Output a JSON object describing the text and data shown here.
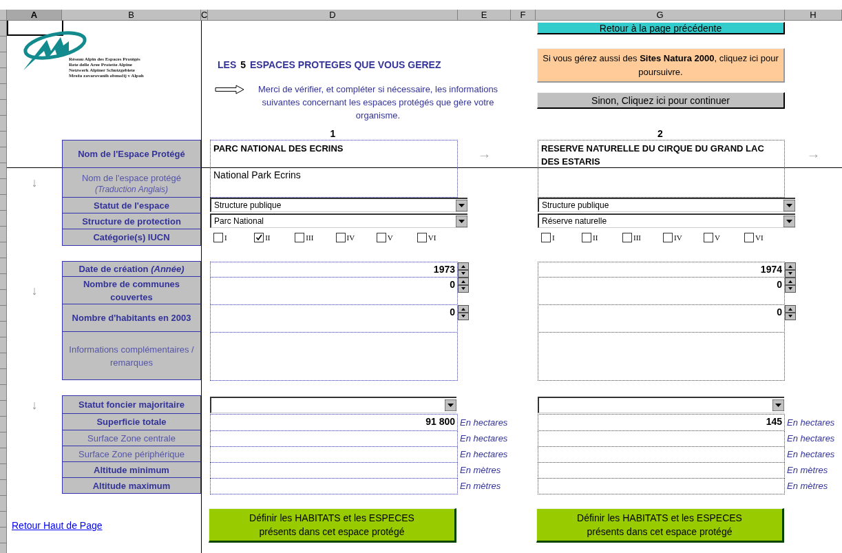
{
  "column_headers": [
    {
      "label": "A",
      "selected": true
    },
    {
      "label": "B",
      "selected": false
    },
    {
      "label": "C",
      "selected": false
    },
    {
      "label": "D",
      "selected": false
    },
    {
      "label": "E",
      "selected": false
    },
    {
      "label": "F",
      "selected": false
    },
    {
      "label": "G",
      "selected": false
    },
    {
      "label": "H",
      "selected": false
    }
  ],
  "logo": {
    "lines": [
      "Réseau Alpin des Espaces Protégés",
      "Rete delle Aree Protette Alpine",
      "Netzwerk Alpiner Schutzgebiete",
      "Mreža zavarovanih območij v Alpah"
    ]
  },
  "title": {
    "prefix": "LES",
    "count": "5",
    "suffix": "ESPACES PROTEGES QUE VOUS GEREZ"
  },
  "instruction": "Merci de vérifier, et compléter si nécessaire, les informations suivantes concernant les espaces protégés que gère votre organisme.",
  "top_buttons": {
    "back": "Retour à la page précédente",
    "natura": "Si vous gérez aussi des **Sites Natura 2000**, cliquez ici pour poursuivre.",
    "continue": "Sinon, Cliquez ici pour continuer"
  },
  "labels": [
    {
      "text": "Nom de l'Espace Protégé",
      "bold": true
    },
    {
      "text": "Nom de l'espace protégé",
      "note": "(Traduction Anglais)",
      "bold": false
    },
    {
      "text": "Statut de l'espace",
      "bold": true
    },
    {
      "text": "Structure de protection",
      "bold": true
    },
    {
      "text": "Catégorie(s)  IUCN",
      "bold": true
    },
    {
      "text": "Date de création *(Année)*",
      "bold": true
    },
    {
      "text": "Nombre de communes couvertes",
      "bold": true
    },
    {
      "text": "Nombre d'habitants en 2003",
      "bold": true
    },
    {
      "text": "Informations complémentaires / remarques",
      "bold": false
    },
    {
      "text": "Statut foncier majoritaire",
      "bold": true
    },
    {
      "text": "Superficie totale",
      "bold": true
    },
    {
      "text": "Surface Zone centrale",
      "bold": false
    },
    {
      "text": "Surface Zone périphérique",
      "bold": false
    },
    {
      "text": "Altitude minimum",
      "bold": true
    },
    {
      "text": "Altitude maximum",
      "bold": true
    }
  ],
  "row_arrows": [
    "↓",
    "↓",
    "↓"
  ],
  "sites": [
    {
      "number": "1",
      "name": "PARC NATIONAL DES ECRINS",
      "next_arrow": "→",
      "translation": "National Park Ecrins",
      "statut": "Structure publique",
      "structure": "Parc National",
      "iucn": [
        {
          "label": "I",
          "checked": false
        },
        {
          "label": "II",
          "checked": true
        },
        {
          "label": "III",
          "checked": false
        },
        {
          "label": "IV",
          "checked": false
        },
        {
          "label": "V",
          "checked": false
        },
        {
          "label": "VI",
          "checked": false
        }
      ],
      "counters": [
        "1973",
        "0",
        "0"
      ],
      "areas": [
        {
          "value": "91 800",
          "unit": "En hectares"
        },
        {
          "unit": "En hectares"
        },
        {
          "unit": "En hectares"
        },
        {
          "unit": "En mètres"
        },
        {
          "unit": "En mètres"
        }
      ],
      "button_lines": [
        "Définir les HABITATS et les ESPECES",
        "présents dans cet espace protégé"
      ]
    },
    {
      "number": "2",
      "name": "RESERVE NATURELLE DU CIRQUE DU GRAND LAC DES ESTARIS",
      "next_arrow": "→",
      "statut": "Structure publique",
      "structure": "Réserve naturelle",
      "iucn": [
        {
          "label": "I",
          "checked": false
        },
        {
          "label": "II",
          "checked": false
        },
        {
          "label": "III",
          "checked": false
        },
        {
          "label": "IV",
          "checked": false
        },
        {
          "label": "V",
          "checked": false
        },
        {
          "label": "VI",
          "checked": false
        }
      ],
      "counters": [
        "1974",
        "0",
        "0"
      ],
      "areas": [
        {
          "value": "145",
          "unit": "En hectares"
        },
        {
          "unit": "En hectares"
        },
        {
          "unit": "En hectares"
        },
        {
          "unit": "En mètres"
        },
        {
          "unit": "En mètres"
        }
      ],
      "button_lines": [
        "Définir les HABITATS et les ESPECES",
        "présents dans cet espace protégé"
      ]
    }
  ],
  "link": "Retour Haut de Page"
}
